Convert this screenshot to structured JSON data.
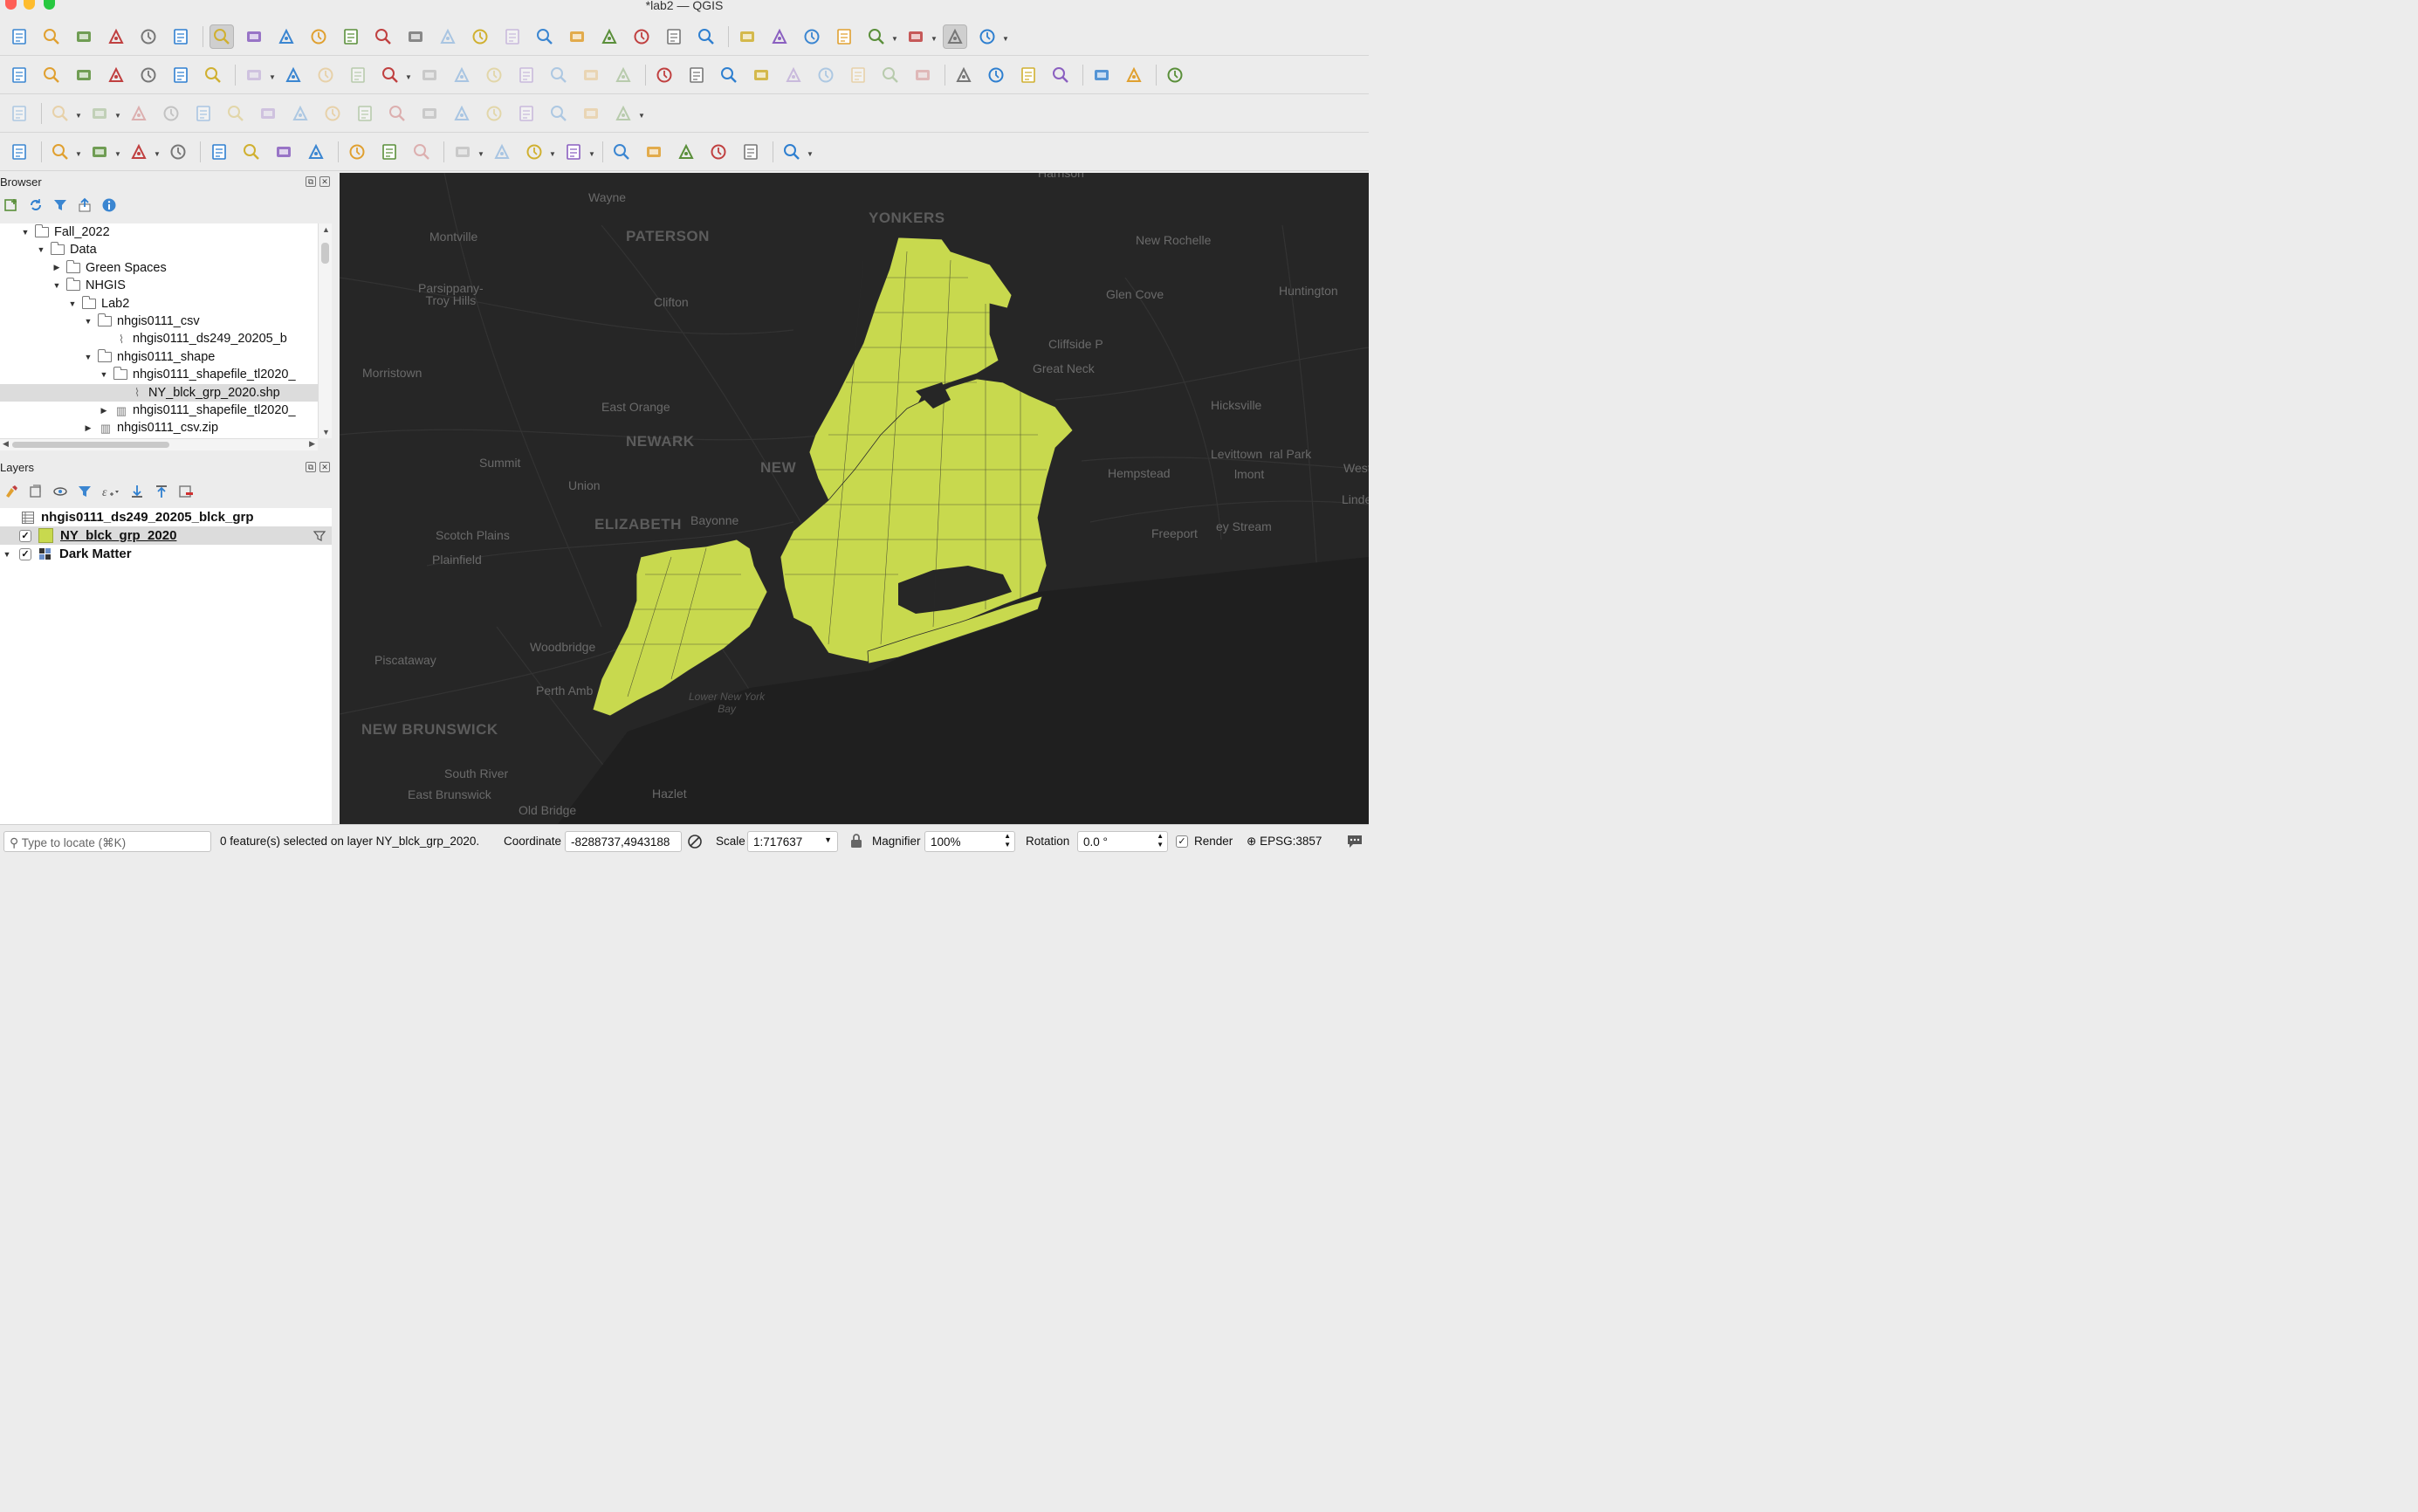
{
  "window": {
    "title": "*lab2 — QGIS"
  },
  "toolbar_icons": {
    "row1": [
      "new-project-icon",
      "open-project-icon",
      "save-project-icon",
      "new-print-layout-icon",
      "layout-manager-icon",
      "style-manager-icon",
      "pan-icon",
      "pan-to-selection-icon",
      "zoom-in-icon",
      "zoom-out-icon",
      "zoom-full-icon",
      "zoom-to-selection-icon",
      "zoom-to-layer-icon",
      "zoom-native-icon",
      "zoom-last-icon",
      "zoom-next-icon",
      "new-map-view-icon",
      "new-3d-view-icon",
      "new-bookmark-icon",
      "show-bookmarks-icon",
      "temporal-controller-icon",
      "refresh-icon",
      "identify-icon",
      "attribute-table-icon",
      "processing-toolbox-icon",
      "statistics-sum-icon",
      "open-table-icon",
      "measure-icon",
      "map-tips-icon",
      "settings-icon"
    ],
    "row2": [
      "data-source-manager-icon",
      "new-geopackage-layer-icon",
      "new-shapefile-layer-icon",
      "new-temporary-layer-icon",
      "new-virtual-layer-icon",
      "new-spatialite-layer-icon",
      "new-mesh-layer-icon",
      "current-edits-icon",
      "toggle-editing-icon",
      "save-edits-icon",
      "add-feature-icon",
      "vertex-tool-icon",
      "modify-attributes-icon",
      "delete-selected-icon",
      "cut-features-icon",
      "copy-features-icon",
      "paste-features-icon",
      "undo-icon",
      "redo-icon",
      "label-abc-icon",
      "diagram-icon",
      "pin-labels-icon",
      "highlight-labels-icon",
      "label-tool-1-icon",
      "label-tool-2-icon",
      "label-tool-3-icon",
      "label-tool-4-icon",
      "label-tool-5-icon",
      "globe-add-icon",
      "globe-search-icon",
      "lifesaver-icon",
      "web-plugin-icon",
      "python-icon",
      "graph-icon",
      "help-icon"
    ],
    "row3": [
      "digitize-angle-icon",
      "digitize-line-icon",
      "reshape-icon",
      "offset-icon",
      "rotate-icon",
      "simplify-icon",
      "add-ring-icon",
      "add-part-icon",
      "fill-ring-icon",
      "delete-ring-icon",
      "delete-part-icon",
      "reshape-features-icon",
      "offset-curve-icon",
      "split-features-icon",
      "split-parts-icon",
      "merge-features-icon",
      "merge-attributes-icon",
      "rotate-point-icon",
      "trim-extend-icon"
    ],
    "row4": [
      "db-manager-icon",
      "select-features-icon",
      "select-by-value-icon",
      "deselect-icon",
      "select-all-icon",
      "trace-icon",
      "multi-line-icon",
      "parallel-icon",
      "reverse-line-icon",
      "checker-1-icon",
      "checker-2-icon",
      "shape-editor-icon",
      "node-select-icon",
      "grid-icon",
      "geometry-checker-icon",
      "label-move-icon",
      "pointer-select-icon",
      "vertex-add-icon",
      "node-connect-icon",
      "star-add-icon",
      "text-add-icon",
      "text-tool-icon"
    ]
  },
  "browser": {
    "title": "Browser",
    "tree": [
      {
        "label": "Fall_2022",
        "indent": 0,
        "type": "folder",
        "expanded": true
      },
      {
        "label": "Data",
        "indent": 1,
        "type": "folder",
        "expanded": true
      },
      {
        "label": "Green Spaces",
        "indent": 2,
        "type": "folder",
        "expanded": false
      },
      {
        "label": "NHGIS",
        "indent": 2,
        "type": "folder",
        "expanded": true
      },
      {
        "label": "Lab2",
        "indent": 3,
        "type": "folder",
        "expanded": true
      },
      {
        "label": "nhgis0111_csv",
        "indent": 4,
        "type": "folder",
        "expanded": true
      },
      {
        "label": "nhgis0111_ds249_20205_b",
        "indent": 5,
        "type": "file"
      },
      {
        "label": "nhgis0111_shape",
        "indent": 4,
        "type": "folder",
        "expanded": true
      },
      {
        "label": "nhgis0111_shapefile_tl2020_",
        "indent": 5,
        "type": "folder",
        "expanded": true
      },
      {
        "label": "NY_blck_grp_2020.shp",
        "indent": 6,
        "type": "file",
        "selected": true
      },
      {
        "label": "nhgis0111_shapefile_tl2020_",
        "indent": 5,
        "type": "zip",
        "expanded": false
      },
      {
        "label": "nhgis0111_csv.zip",
        "indent": 4,
        "type": "zip",
        "expanded": false
      }
    ]
  },
  "layers": {
    "title": "Layers",
    "items": [
      {
        "label": "nhgis0111_ds249_20205_blck_grp",
        "checked": null,
        "icon": "table-icon"
      },
      {
        "label": "NY_blck_grp_2020",
        "checked": true,
        "icon": "polygon-symbol",
        "swatch": "#c8d94e",
        "selected": true
      },
      {
        "label": "Dark Matter",
        "checked": true,
        "icon": "raster-tiles-icon"
      }
    ]
  },
  "map": {
    "background": "#262626",
    "fill_color": "#c8d94e",
    "labels": [
      {
        "text": "Harrison"
      },
      {
        "text": "Wayne"
      },
      {
        "text": "YONKERS",
        "big": true
      },
      {
        "text": "PATERSON",
        "big": true
      },
      {
        "text": "Montville"
      },
      {
        "text": "New Rochelle"
      },
      {
        "text": "Parsippany-\nTroy Hills"
      },
      {
        "text": "Clifton"
      },
      {
        "text": "Glen Cove"
      },
      {
        "text": "Huntington"
      },
      {
        "text": "Cliffside P"
      },
      {
        "text": "Morristown"
      },
      {
        "text": "Great Neck"
      },
      {
        "text": "East Orange"
      },
      {
        "text": "Hicksville"
      },
      {
        "text": "NEWARK",
        "big": true
      },
      {
        "text": "NEW",
        "big": true
      },
      {
        "text": "Summit"
      },
      {
        "text": "Levittown"
      },
      {
        "text": "ral Park"
      },
      {
        "text": "lmont"
      },
      {
        "text": "Hempstead"
      },
      {
        "text": "West"
      },
      {
        "text": "Union"
      },
      {
        "text": "Lindenh"
      },
      {
        "text": "ELIZABETH",
        "big": true
      },
      {
        "text": "Bayonne"
      },
      {
        "text": "Scotch Plains"
      },
      {
        "text": "ey Stream"
      },
      {
        "text": "Freeport"
      },
      {
        "text": "Plainfield"
      },
      {
        "text": "Woodbridge"
      },
      {
        "text": "Piscataway"
      },
      {
        "text": "Perth Amb"
      },
      {
        "text": "Lower New York\nBay",
        "water": true
      },
      {
        "text": "NEW BRUNSWICK",
        "big": true
      },
      {
        "text": "South River"
      },
      {
        "text": "East Brunswick"
      },
      {
        "text": "Hazlet"
      },
      {
        "text": "Old Bridge"
      }
    ]
  },
  "status": {
    "locator_placeholder": "Type to locate (⌘K)",
    "message": "0 feature(s) selected on layer NY_blck_grp_2020.",
    "coordinate_label": "Coordinate",
    "coordinate_value": "-8288737,4943188",
    "scale_label": "Scale",
    "scale_value": "1:717637",
    "magnifier_label": "Magnifier",
    "magnifier_value": "100%",
    "rotation_label": "Rotation",
    "rotation_value": "0.0 °",
    "render_label": "Render",
    "render_checked": true,
    "crs": "EPSG:3857"
  }
}
